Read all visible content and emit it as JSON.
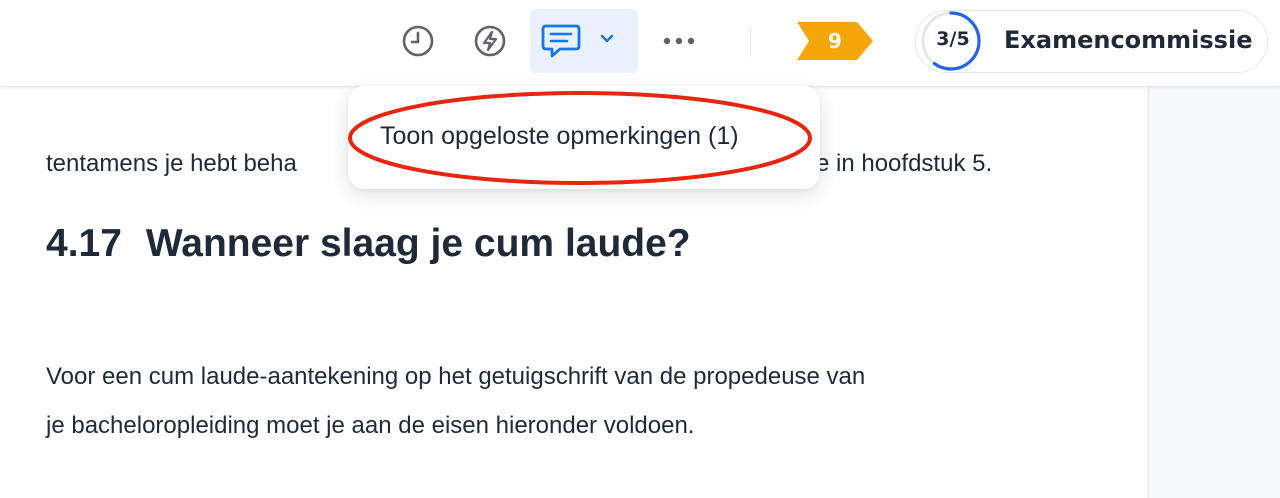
{
  "toolbar": {
    "icons": {
      "history": "clock-icon",
      "actions": "lightning-bolt-icon",
      "comments": "comment-bubble-icon",
      "comments_menu": "chevron-down-icon",
      "more": "more-horizontal-icon"
    },
    "badge": {
      "value": "9",
      "color": "#f5a70a"
    },
    "status": {
      "progress_label": "3/5",
      "progress_fraction": 0.6,
      "name": "Examencommissie",
      "accent": "#2563eb"
    }
  },
  "dropdown": {
    "item_label": "Toon opgeloste opmerkingen (1)",
    "highlight_color": "#e8260f"
  },
  "document": {
    "partial_line_left": "tentamens je hebt beha",
    "partial_line_right": "e in hoofdstuk 5.",
    "heading_number": "4.17",
    "heading_text": "Wanneer slaag je cum laude?",
    "paragraph_lines": [
      "Voor een cum laude-aantekening op het getuigschrift van de propedeuse van",
      "je bacheloropleiding moet je aan de eisen hieronder voldoen."
    ]
  }
}
